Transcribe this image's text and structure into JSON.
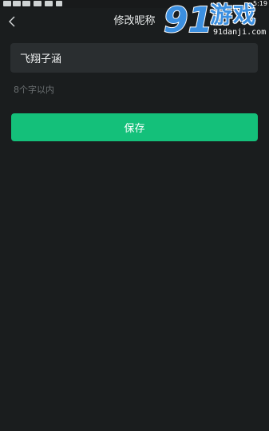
{
  "status_bar": {
    "time": "5:19"
  },
  "nav": {
    "title": "修改昵称"
  },
  "nickname": {
    "value": "飞翔子涵"
  },
  "hint": "8个字以内",
  "save_label": "保存",
  "watermark": {
    "brand": "游戏",
    "url": "91danji.com"
  },
  "colors": {
    "background": "#1a1d1e",
    "field": "#2a2e30",
    "accent": "#14c07a",
    "hint": "#6b7072"
  }
}
